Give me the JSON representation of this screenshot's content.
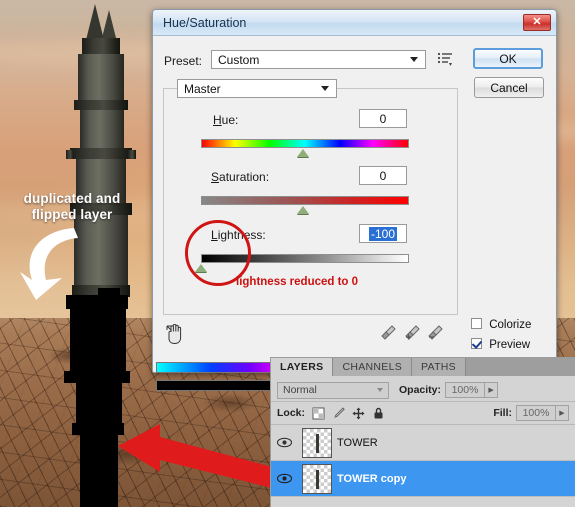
{
  "photo": {
    "annotation_main": "duplicated and",
    "annotation_main2": "flipped layer",
    "white_arrow_icon": "curved-arrow-icon",
    "red_arrow_icon": "arrow-pointing-left-icon"
  },
  "dialog": {
    "title": "Hue/Saturation",
    "close_label": "✕",
    "preset_label": "Preset:",
    "preset_value": "Custom",
    "preset_menu_icon": "preset-options-icon",
    "ok_label": "OK",
    "cancel_label": "Cancel",
    "channel_value": "Master",
    "hue_label": "Hue:",
    "hue_value": "0",
    "saturation_label": "Saturation:",
    "saturation_value": "0",
    "lightness_label": "Lightness:",
    "lightness_value": "-100",
    "red_note": "lightness reduced to 0",
    "onimage_tool_icon": "on-image-adjust-hand-icon",
    "eyedropper_icon": "eyedropper-icon",
    "eyedropper_add_icon": "eyedropper-plus-icon",
    "eyedropper_sub_icon": "eyedropper-minus-icon",
    "colorize_label": "Colorize",
    "colorize_checked": false,
    "preview_label": "Preview",
    "preview_checked": true
  },
  "layers_panel": {
    "tabs": [
      {
        "label": "LAYERS",
        "active": true
      },
      {
        "label": "CHANNELS",
        "active": false
      },
      {
        "label": "PATHS",
        "active": false
      }
    ],
    "blend_mode": "Normal",
    "opacity_label": "Opacity:",
    "opacity_value": "100%",
    "lock_label": "Lock:",
    "lock_icons": [
      "lock-transparency-icon",
      "lock-image-icon",
      "lock-position-icon",
      "lock-all-icon"
    ],
    "fill_label": "Fill:",
    "fill_value": "100%",
    "layers": [
      {
        "name": "TOWER",
        "visible": true,
        "selected": false,
        "eye_icon": "eye-icon"
      },
      {
        "name": "TOWER copy",
        "visible": true,
        "selected": true,
        "eye_icon": "eye-icon"
      }
    ]
  },
  "colors": {
    "selection_blue": "#3d96f0",
    "red_annotation": "#cc1111",
    "dialog_bg": "#f0f0f0",
    "titlebar_blue": "#c3dbef"
  }
}
